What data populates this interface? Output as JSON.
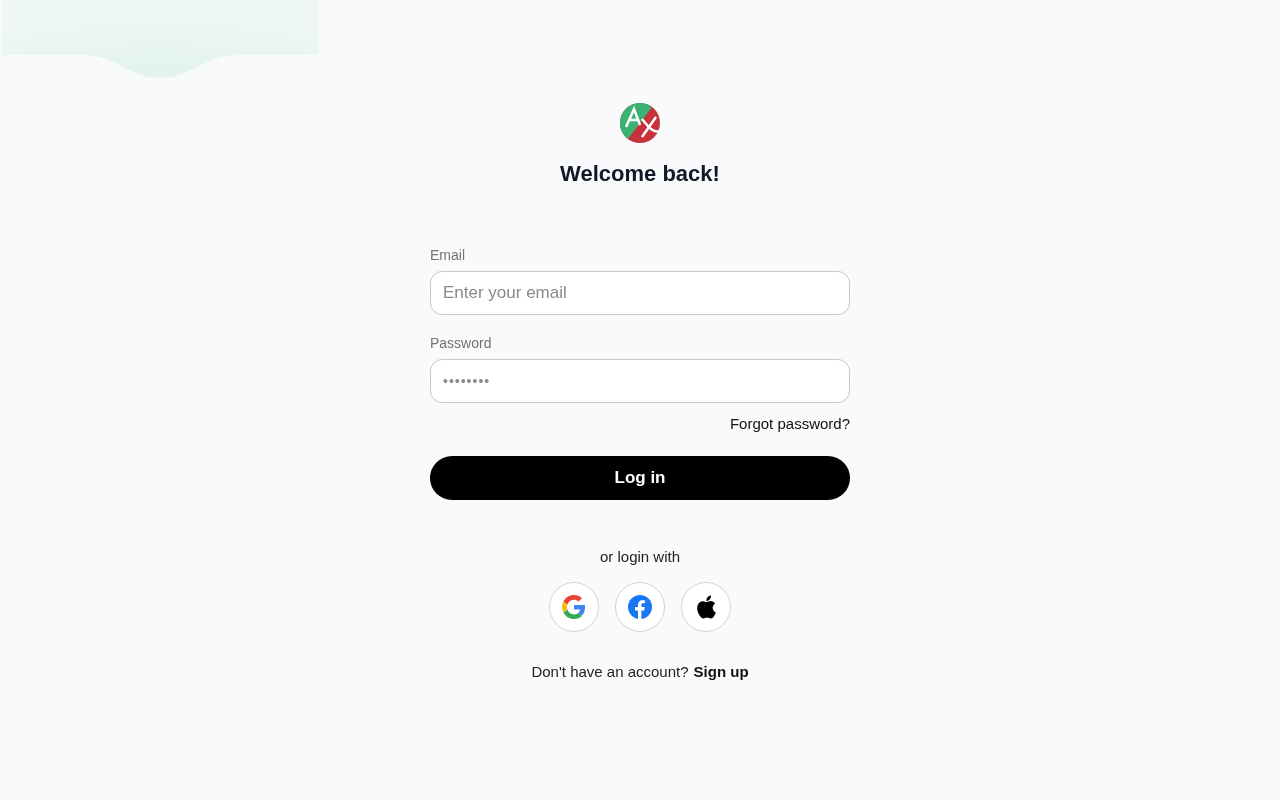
{
  "title": "Welcome back!",
  "fields": [
    {
      "label": "Email",
      "placeholder": "Enter your email",
      "kind": "email"
    },
    {
      "label": "Password",
      "placeholder": "••••••••",
      "kind": "password"
    }
  ],
  "forgot_link": "Forgot password?",
  "login_button": "Log in",
  "divider_text": "or login with",
  "social": [
    {
      "kind": "google"
    },
    {
      "kind": "facebook"
    },
    {
      "kind": "apple"
    }
  ],
  "signup": {
    "prompt": "Don't have an account?",
    "link": "Sign up"
  }
}
